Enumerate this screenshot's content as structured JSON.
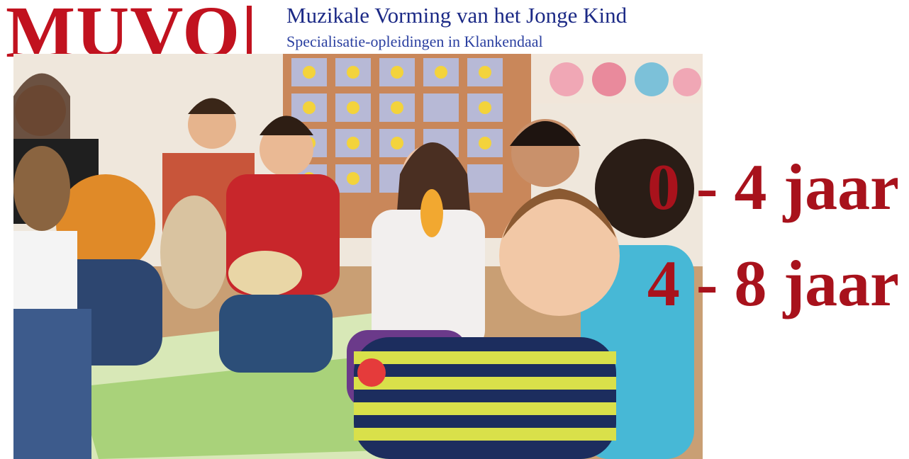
{
  "header": {
    "logo_text": "MUVO",
    "title": "Muzikale Vorming van het Jonge Kind",
    "subtitle": "Specialisatie-opleidingen in Klankendaal"
  },
  "age_ranges": [
    "0 - 4 jaar",
    "4 - 8 jaar"
  ],
  "colors": {
    "brand_red": "#c1121f",
    "title_blue": "#1c2a86",
    "age_red": "#a8121c"
  }
}
